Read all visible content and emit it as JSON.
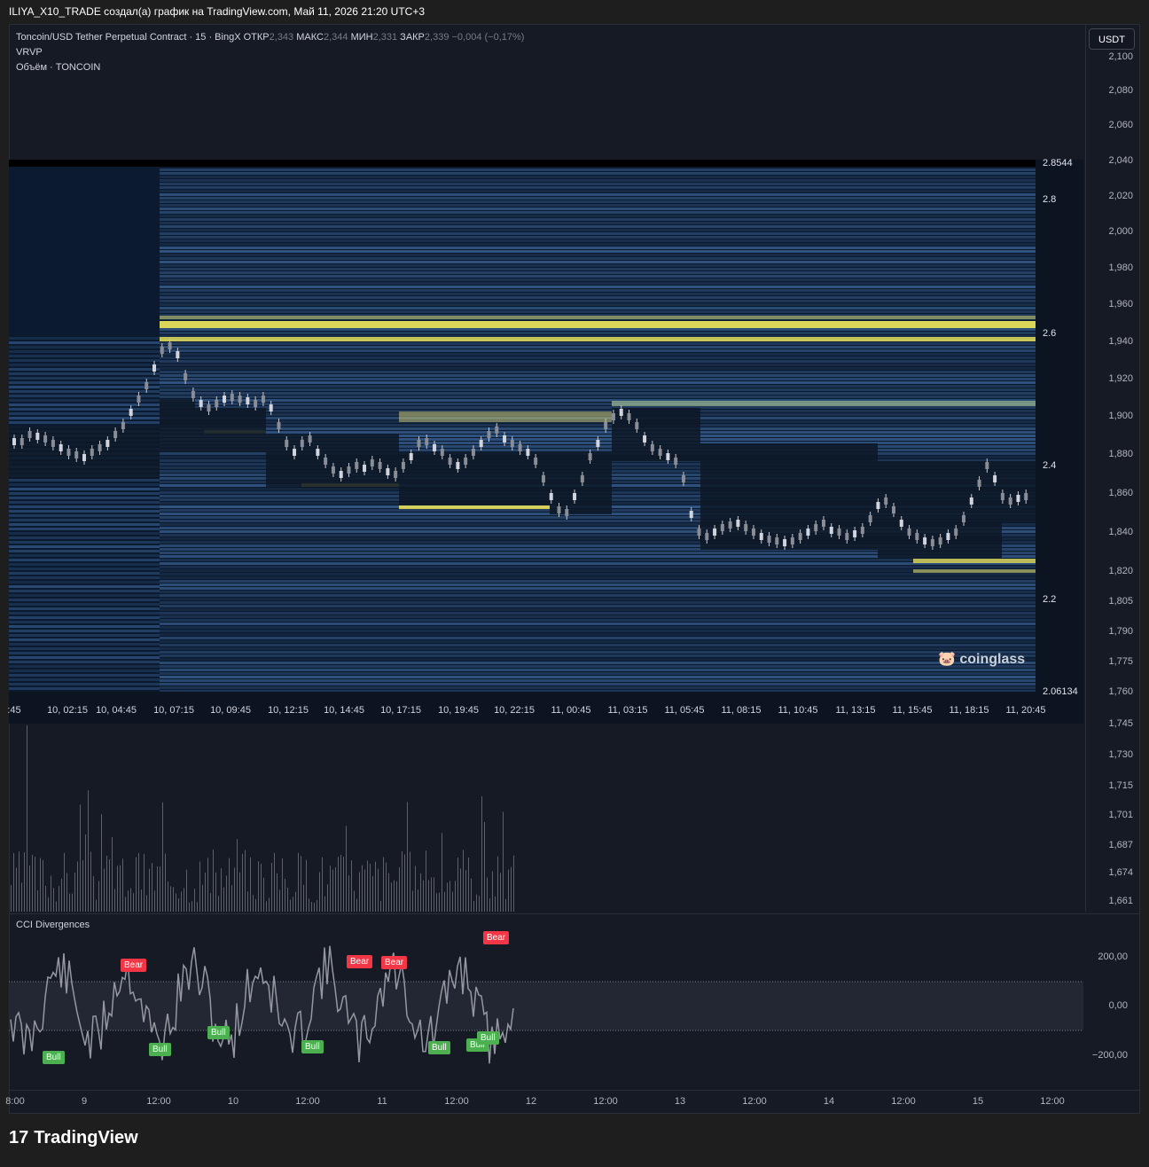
{
  "header": {
    "title": "ILIYA_X10_TRADE создал(а) график на TradingView.com, Май 11, 2026 21:20 UTC+3"
  },
  "legend": {
    "symbol": "Toncoin/USD Tether Perpetual Contract · 15 · BingX",
    "open_label": "ОТКР",
    "open_value": "2,343",
    "high_label": "МАКС",
    "high_value": "2,344",
    "low_label": "МИН",
    "low_value": "2,331",
    "close_label": "ЗАКР",
    "close_value": "2,339",
    "change": "−0,004 (−0,17%)",
    "indicator_1": "VRVP",
    "indicator_2": "Объём · TONCOIN"
  },
  "currency_button": "USDT",
  "price_scale": [
    "2,100",
    "2,080",
    "2,060",
    "2,040",
    "2,020",
    "2,000",
    "1,980",
    "1,960",
    "1,940",
    "1,920",
    "1,900",
    "1,880",
    "1,860",
    "1,840",
    "1,820",
    "1,805",
    "1,790",
    "1,775",
    "1,760",
    "1,745",
    "1,730",
    "1,715",
    "1,701",
    "1,687",
    "1,674",
    "1,661"
  ],
  "heatmap": {
    "scale": [
      "2.8544",
      "2.8",
      "2.6",
      "2.4",
      "2.2",
      "2.06134"
    ],
    "times": [
      ":45",
      "10, 02:15",
      "10, 04:45",
      "10, 07:15",
      "10, 09:45",
      "10, 12:15",
      "10, 14:45",
      "10, 17:15",
      "10, 19:45",
      "10, 22:15",
      "11, 00:45",
      "11, 03:15",
      "11, 05:45",
      "11, 08:15",
      "11, 10:45",
      "11, 13:15",
      "11, 15:45",
      "11, 18:15",
      "11, 20:45"
    ],
    "watermark": "coinglass"
  },
  "cci": {
    "title": "CCI Divergences",
    "levels": [
      "200,00",
      "0,00",
      "−200,00"
    ],
    "badges": [
      {
        "label": "Bear",
        "type": "bear"
      },
      {
        "label": "Bear",
        "type": "bear"
      },
      {
        "label": "Bear",
        "type": "bear"
      },
      {
        "label": "Bear",
        "type": "bear"
      },
      {
        "label": "Bull",
        "type": "bull"
      },
      {
        "label": "Bull",
        "type": "bull"
      },
      {
        "label": "Bull",
        "type": "bull"
      },
      {
        "label": "Bull",
        "type": "bull"
      },
      {
        "label": "Bull",
        "type": "bull"
      },
      {
        "label": "Bull",
        "type": "bull"
      },
      {
        "label": "Bull",
        "type": "bull"
      }
    ]
  },
  "time_axis": [
    "8:00",
    "9",
    "12:00",
    "10",
    "12:00",
    "11",
    "12:00",
    "12",
    "12:00",
    "13",
    "12:00",
    "14",
    "12:00",
    "15",
    "12:00"
  ],
  "footer": {
    "logo_mark": "17",
    "logo_text": "TradingView"
  },
  "colors": {
    "background": "#161a25",
    "heat_low": "#0c1a2c",
    "heat_mid": "#3a6aa8",
    "heat_high": "#f2e94e",
    "bear": "#f23645",
    "bull": "#4caf50"
  }
}
